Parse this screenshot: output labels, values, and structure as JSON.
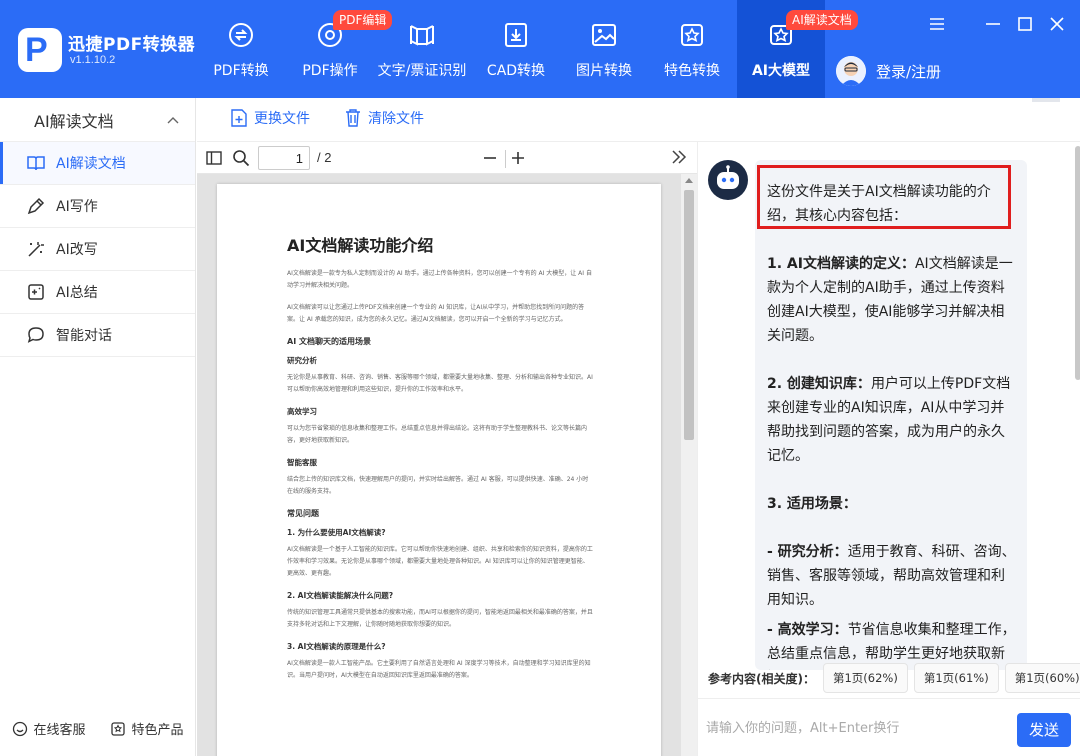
{
  "app": {
    "name": "迅捷PDF转换器",
    "version": "v1.1.10.2",
    "brand_color": "#2b6cf6",
    "active_color": "#1452d6",
    "badge_color": "#ff4a3d"
  },
  "nav": [
    {
      "label": "PDF转换",
      "icon": "pdf-convert-icon"
    },
    {
      "label": "PDF操作",
      "icon": "pdf-operation-icon",
      "badge": "PDF编辑"
    },
    {
      "label": "文字/票证识别",
      "icon": "ocr-icon"
    },
    {
      "label": "CAD转换",
      "icon": "cad-icon"
    },
    {
      "label": "图片转换",
      "icon": "image-icon"
    },
    {
      "label": "特色转换",
      "icon": "special-icon"
    },
    {
      "label": "AI大模型",
      "icon": "ai-model-icon",
      "badge": "AI解读文档",
      "active": true
    }
  ],
  "user": {
    "login_label": "登录/注册"
  },
  "sidebar": {
    "header": "AI解读文档",
    "items": [
      {
        "label": "AI解读文档",
        "icon": "book-icon",
        "active": true
      },
      {
        "label": "AI写作",
        "icon": "pen-icon"
      },
      {
        "label": "AI改写",
        "icon": "magic-wand-icon"
      },
      {
        "label": "AI总结",
        "icon": "summary-icon"
      },
      {
        "label": "智能对话",
        "icon": "chat-icon"
      }
    ],
    "footer": {
      "service": "在线客服",
      "products": "特色产品"
    }
  },
  "filebar": {
    "replace": "更换文件",
    "clear": "清除文件"
  },
  "viewer": {
    "page_current": "1",
    "page_total": "/ 2"
  },
  "document": {
    "title": "AI文档解读功能介绍",
    "p1": "AI文档解读是一款专为私人定制而设计的 AI 助手。通过上传各种资料，您可以创建一个专有的 AI 大模型，让 AI 自动学习并解决相关问题。",
    "p2": "AI文档解读可以让您通过上传PDF文档来创建一个专业的 AI 知识库，让AI从中学习，并帮助您找到所问问题的答案。让 AI 承载您的知识，成为您的永久记忆。通过AI文档解读，您可以开启一个全新的学习与记忆方式。",
    "s1": "AI 文档聊天的适用场景",
    "s1a": "研究分析",
    "s1a_text": "无论你是从事教育、科研、咨询、销售、客服等哪个领域，都需要大量地收集、整理、分析和输出各种专业知识。AI可以帮助你高效地管理和利用这些知识，提升你的工作效率和水平。",
    "s1b": "高效学习",
    "s1b_text": "可以为您节省繁琐的信息收集和整理工作。总结重点信息并得出结论。这将有助于学生整理教科书、论文等长篇内容，更好地获取新知识。",
    "s1c": "智能客服",
    "s1c_text": "结合您上传的知识库文档，快速理解用户的提问，并实时给出解答。通过 AI 客服，可以提供快速、准确、24 小时在线的服务支持。",
    "s2": "常见问题",
    "q1": "1. 为什么要使用AI文档解读?",
    "q1_text": "AI文档解读是一个基于人工智能的知识库。它可以帮助你快速地创建、组织、共享和检索你的知识资料，提高你的工作效率和学习效果。无论你是从事哪个领域，都需要大量地处理各种知识。AI 知识库可以让你的知识管理更智能、更高效、更有趣。",
    "q2": "2. AI文档解读能解决什么问题?",
    "q2_text": "传统的知识管理工具通常只提供基本的搜索功能，而AI可以根据你的提问，智能地返回最相关和最准确的答案，并且支持多轮对话和上下文理解，让你随时随地获取你想要的知识。",
    "q3": "3. AI文档解读的原理是什么?",
    "q3_text": "AI文档解读是一款人工智能产品。它主要利用了自然语言处理和 AI 深度学习等技术，自动整理和学习知识库里的知识。当用户提问时，AI大模型在自动返回知识库里返回最准确的答案。"
  },
  "chat": {
    "lead": "这份文件是关于AI文档解读功能的介绍，其核心内容包括：",
    "b1_title": "1. AI文档解读的定义：",
    "b1_text": "AI文档解读是一款为个人定制的AI助手，通过上传资料创建AI大模型，使AI能够学习并解决相关问题。",
    "b2_title": "2. 创建知识库：",
    "b2_text": "用户可以上传PDF文档来创建专业的AI知识库，AI从中学习并帮助找到问题的答案，成为用户的永久记忆。",
    "b3_title": "3. 适用场景：",
    "b3a_title": "- 研究分析：",
    "b3a_text": "适用于教育、科研、咨询、销售、客服等领域，帮助高效管理和利用知识。",
    "b3b_title": "- 高效学习：",
    "b3b_text": "节省信息收集和整理工作，总结重点信息，帮助学生更好地获取新知识。",
    "refs_label": "参考内容(相关度)：",
    "refs": [
      "第1页(62%)",
      "第1页(61%)",
      "第1页(60%)"
    ],
    "refs_more": "›",
    "input_placeholder": "请输入你的问题，Alt+Enter换行",
    "send": "发送"
  }
}
